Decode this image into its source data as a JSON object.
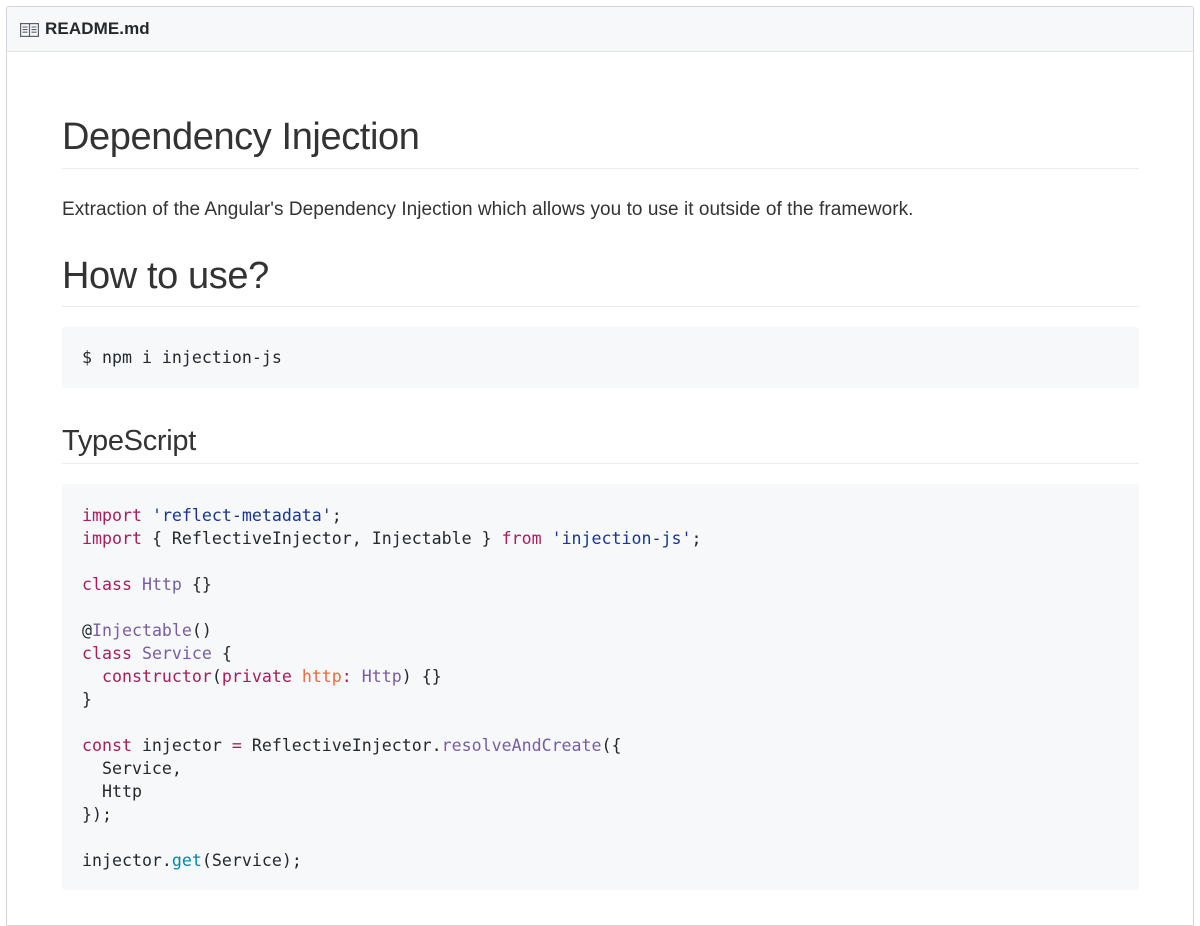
{
  "header": {
    "icon": "book-icon",
    "file_name": "README.md"
  },
  "content": {
    "title": "Dependency Injection",
    "description": "Extraction of the Angular's Dependency Injection which allows you to use it outside of the framework.",
    "section_how_to_use": "How to use?",
    "install_command": "$ npm i injection-js",
    "section_typescript": "TypeScript",
    "code": {
      "l1_kw": "import",
      "l1_str": "'reflect-metadata'",
      "l1_end": ";",
      "l2_kw": "import",
      "l2_mid": " { ReflectiveInjector, Injectable } ",
      "l2_from": "from",
      "l2_str": "'injection-js'",
      "l2_end": ";",
      "l3_kw": "class",
      "l3_name": "Http",
      "l3_end": " {}",
      "l4_at": "@",
      "l4_dec": "Injectable",
      "l4_end": "()",
      "l5_kw": "class",
      "l5_name": "Service",
      "l5_end": " {",
      "l6_indent": "  ",
      "l6_ctor": "constructor",
      "l6_open": "(",
      "l6_priv": "private",
      "l6_param": "http",
      "l6_colon": ": ",
      "l6_type": "Http",
      "l6_end": ") {}",
      "l7": "}",
      "l8_kw": "const",
      "l8_var": " injector ",
      "l8_eq": "=",
      "l8_obj": " ReflectiveInjector.",
      "l8_fn": "resolveAndCreate",
      "l8_end": "({",
      "l9": "  Service,",
      "l10": "  Http",
      "l11": "});",
      "l12_obj": "injector.",
      "l12_fn": "get",
      "l12_end": "(Service);"
    }
  },
  "colors": {
    "keyword": "#a71d5d",
    "string": "#183691",
    "entity": "#795da3",
    "parameter": "#ed6a43",
    "support": "#0086b3",
    "code_background": "#f6f8fa",
    "header_background": "#f6f8fa"
  }
}
